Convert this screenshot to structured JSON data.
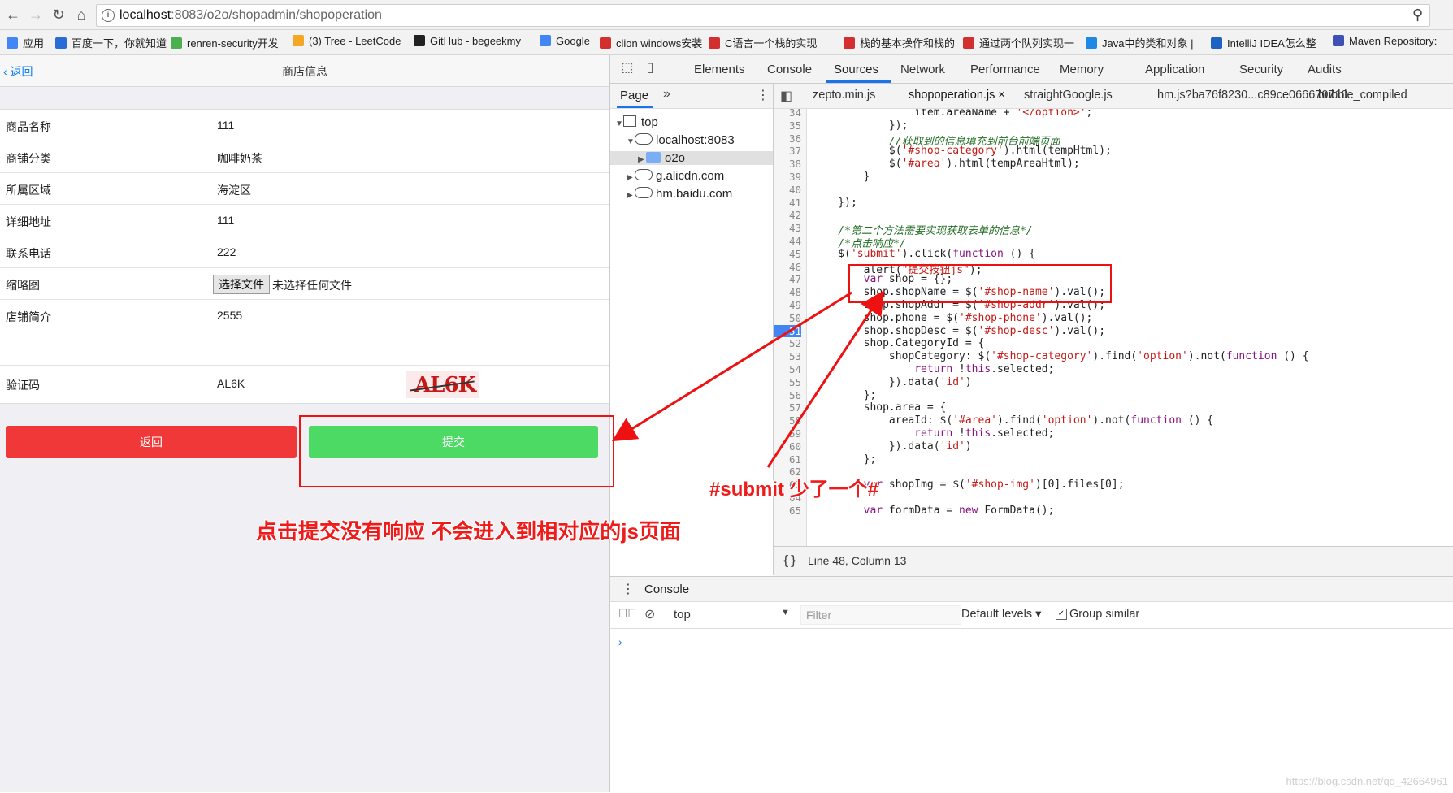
{
  "browser": {
    "url_host": "localhost",
    "url_rest": ":8083/o2o/shopadmin/shopoperation",
    "bookmarks": [
      "应用",
      "百度一下，你就知道",
      "renren-security开发",
      "(3) Tree - LeetCode",
      "GitHub - begeekmy",
      "Google",
      "clion windows安装",
      "C语言一个栈的实现",
      "栈的基本操作和栈的",
      "通过两个队列实现一",
      "Java中的类和对象 |",
      "IntelliJ IDEA怎么整",
      "Maven Repository:"
    ]
  },
  "app": {
    "back_label": "返回",
    "title": "商店信息",
    "rows": [
      {
        "label": "商品名称",
        "value": "111"
      },
      {
        "label": "商铺分类",
        "value": "咖啡奶茶"
      },
      {
        "label": "所属区域",
        "value": "海淀区"
      },
      {
        "label": "详细地址",
        "value": "111"
      },
      {
        "label": "联系电话",
        "value": "222"
      },
      {
        "label": "缩略图",
        "value": ""
      },
      {
        "label": "店铺简介",
        "value": "2555"
      },
      {
        "label": "验证码",
        "value": "AL6K"
      }
    ],
    "file_button": "选择文件",
    "file_none": "未选择任何文件",
    "captcha_text": "AL6K",
    "btn_back": "返回",
    "btn_submit": "提交"
  },
  "devtools": {
    "tabs": [
      "Elements",
      "Console",
      "Sources",
      "Network",
      "Performance",
      "Memory",
      "Application",
      "Security",
      "Audits"
    ],
    "active_tab": "Sources",
    "navigator": {
      "head": "Page",
      "tree": [
        "top",
        "localhost:8083",
        "o2o",
        "g.alicdn.com",
        "hm.baidu.com"
      ]
    },
    "file_tabs": [
      "zepto.min.js",
      "shopoperation.js ×",
      "straightGoogle.js",
      "hm.js?ba76f8230...c89ce066670710",
      "bubble_compiled"
    ],
    "status": "Line 48, Column 13",
    "console": {
      "tab": "Console",
      "context": "top",
      "filter_placeholder": "Filter",
      "levels": "Default levels",
      "group_similar": "Group similar"
    },
    "code_lines": [
      {
        "n": "34",
        "text": "                item.areaName + '</option>';"
      },
      {
        "n": "35",
        "text": "            });"
      },
      {
        "n": "36",
        "text": "            //获取到的信息填充到前台前端页面"
      },
      {
        "n": "37",
        "text": "            $('#shop-category').html(tempHtml);"
      },
      {
        "n": "38",
        "text": "            $('#area').html(tempAreaHtml);"
      },
      {
        "n": "39",
        "text": "        }"
      },
      {
        "n": "40",
        "text": ""
      },
      {
        "n": "41",
        "text": "    });"
      },
      {
        "n": "42",
        "text": ""
      },
      {
        "n": "43",
        "text": "    /*第二个方法需要实现获取表单的信息*/"
      },
      {
        "n": "44",
        "text": "    /*点击响应*/"
      },
      {
        "n": "45",
        "text": "    $('submit').click(function () {"
      },
      {
        "n": "46",
        "text": "        alert(\"提交按钮js\");"
      },
      {
        "n": "47",
        "text": "        var shop = {};"
      },
      {
        "n": "48",
        "text": "        shop.shopName = $('#shop-name').val();"
      },
      {
        "n": "49",
        "text": "        shop.shopAddr = $('#shop-addr').val();"
      },
      {
        "n": "50",
        "text": "        shop.phone = $('#shop-phone').val();"
      },
      {
        "n": "51",
        "text": "        shop.shopDesc = $('#shop-desc').val();"
      },
      {
        "n": "52",
        "text": "        shop.CategoryId = {"
      },
      {
        "n": "53",
        "text": "            shopCategory: $('#shop-category').find('option').not(function () {"
      },
      {
        "n": "54",
        "text": "                return !this.selected;"
      },
      {
        "n": "55",
        "text": "            }).data('id')"
      },
      {
        "n": "56",
        "text": "        };"
      },
      {
        "n": "57",
        "text": "        shop.area = {"
      },
      {
        "n": "58",
        "text": "            areaId: $('#area').find('option').not(function () {"
      },
      {
        "n": "59",
        "text": "                return !this.selected;"
      },
      {
        "n": "60",
        "text": "            }).data('id')"
      },
      {
        "n": "61",
        "text": "        };"
      },
      {
        "n": "62",
        "text": ""
      },
      {
        "n": "63",
        "text": "        var shopImg = $('#shop-img')[0].files[0];"
      },
      {
        "n": "64",
        "text": ""
      },
      {
        "n": "65",
        "text": "        var formData = new FormData();"
      }
    ],
    "breakpoint_line": "51"
  },
  "annotations": {
    "missing_hash": "#submit 少了一个#",
    "no_response": "点击提交没有响应 不会进入到相对应的js页面"
  },
  "watermark": "https://blog.csdn.net/qq_42664961",
  "colors": {
    "accent": "#1a73e8",
    "annotation_red": "#ef1b1b",
    "submit_green": "#4cd964",
    "back_red": "#f03838"
  }
}
